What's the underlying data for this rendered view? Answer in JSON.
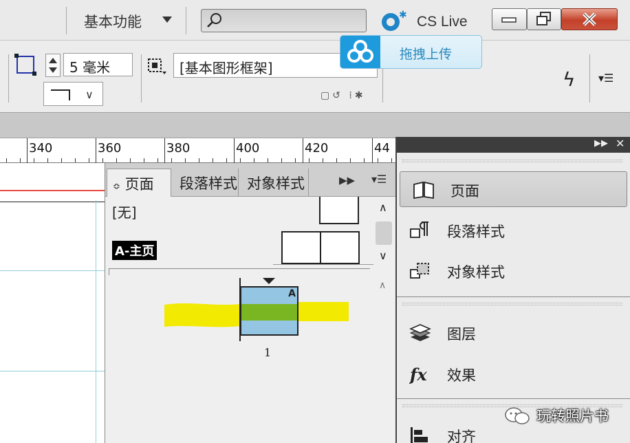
{
  "titlebar": {
    "workspace_label": "基本功能",
    "search_placeholder": "",
    "cslive_label": "CS Live"
  },
  "tooltip": {
    "label": "拖拽上传"
  },
  "control_panel": {
    "stroke_weight": "5 毫米",
    "object_style": "[基本图形框架]"
  },
  "ruler": {
    "labels": [
      "340",
      "360",
      "380",
      "400",
      "420",
      "44"
    ]
  },
  "pages_panel": {
    "tabs": [
      {
        "label": "页面"
      },
      {
        "label": "段落样式"
      },
      {
        "label": "对象样式"
      }
    ],
    "tab_indicator": "≎",
    "none_label": "[无]",
    "master_label": "A-主页",
    "page_prefix": "A",
    "page_number": "1"
  },
  "side_panel": {
    "items": [
      {
        "label": "页面",
        "icon": "pages-icon"
      },
      {
        "label": "段落样式",
        "icon": "paragraph-styles-icon"
      },
      {
        "label": "对象样式",
        "icon": "object-styles-icon"
      },
      {
        "label": "图层",
        "icon": "layers-icon"
      },
      {
        "label": "效果",
        "icon": "fx-icon"
      },
      {
        "label": "对齐",
        "icon": "align-icon"
      }
    ]
  },
  "watermark": {
    "text": "玩转照片书"
  },
  "colors": {
    "tooltip_accent": "#1d9bdc",
    "page_blue": "#94c5e3",
    "page_green": "#7ab622",
    "highlight_yellow": "#f2ea00",
    "close_red": "#c4412a"
  }
}
